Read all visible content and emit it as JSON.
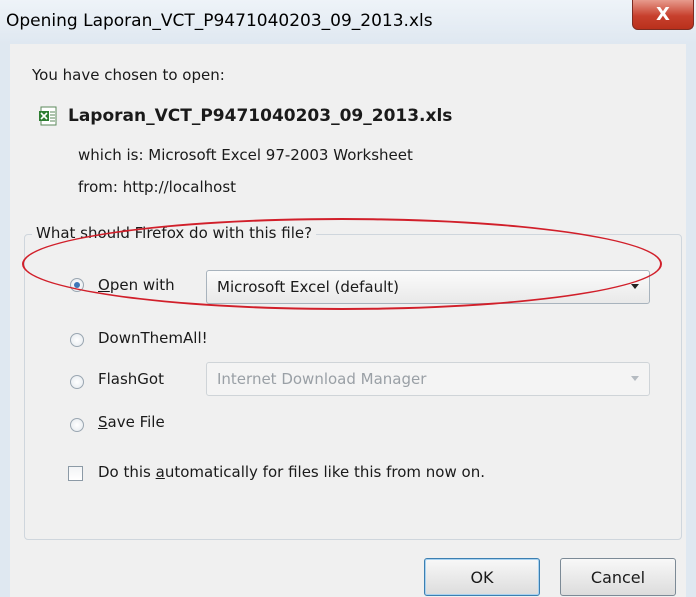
{
  "window": {
    "title": "Opening Laporan_VCT_P9471040203_09_2013.xls",
    "close_label": "X"
  },
  "dialog": {
    "chosen_label": "You have chosen to open:",
    "file_name": "Laporan_VCT_P9471040203_09_2013.xls",
    "file_icon": "excel-file-icon",
    "which_is": "which is:  Microsoft Excel 97-2003 Worksheet",
    "from": "from:  http://localhost",
    "question": "What should Firefox do with this file?",
    "options": [
      {
        "label_pre": "",
        "label_key": "O",
        "label_post": "pen with",
        "selected": true,
        "select_value": "Microsoft Excel (default)",
        "enabled": true
      },
      {
        "label_pre": "DownThemAll!",
        "label_key": "",
        "label_post": "",
        "selected": false,
        "enabled": true
      },
      {
        "label_pre": "FlashGot",
        "label_key": "",
        "label_post": "",
        "selected": false,
        "select_value": "Internet Download Manager",
        "enabled": false
      },
      {
        "label_pre": "",
        "label_key": "S",
        "label_post": "ave File",
        "selected": false,
        "enabled": true
      }
    ],
    "auto_checkbox": {
      "label_pre": "Do this ",
      "label_key": "a",
      "label_post": "utomatically for files like this from now on.",
      "checked": false
    }
  },
  "buttons": {
    "ok": "OK",
    "cancel": "Cancel"
  },
  "colors": {
    "highlight": "#d11f2a",
    "radio_selected": "#3d76b8"
  }
}
